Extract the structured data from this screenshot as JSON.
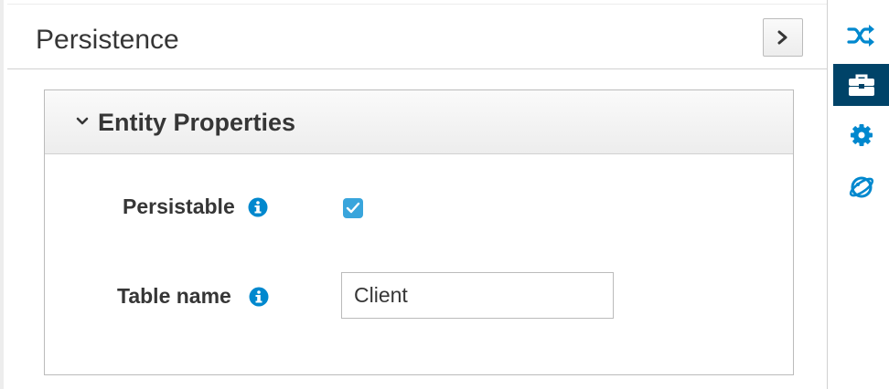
{
  "header": {
    "title": "Persistence"
  },
  "panel": {
    "title": "Entity Properties"
  },
  "form": {
    "persistable": {
      "label": "Persistable",
      "checked": true
    },
    "table_name": {
      "label": "Table name",
      "value": "Client"
    }
  },
  "sidebar": {
    "items": [
      {
        "icon": "shuffle-icon",
        "active": false
      },
      {
        "icon": "briefcase-icon",
        "active": true
      },
      {
        "icon": "gear-icon",
        "active": false
      },
      {
        "icon": "planet-icon",
        "active": false
      }
    ]
  },
  "colors": {
    "accent": "#0088ce",
    "active_bg": "#004368",
    "checkbox": "#39a5dc",
    "text": "#363636"
  }
}
